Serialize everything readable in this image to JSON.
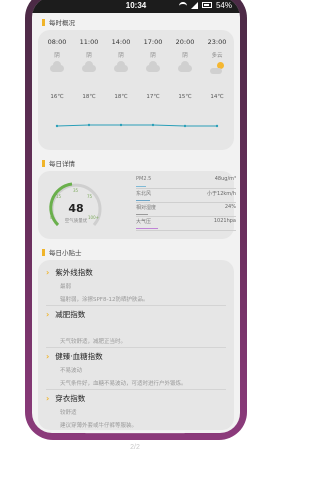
{
  "status": {
    "time": "10:34",
    "battery": "54%"
  },
  "hourly": {
    "title": "每时概况",
    "hours": [
      {
        "time": "08:00",
        "weather": "阴",
        "icon": "cloud-icon",
        "temp": "16℃"
      },
      {
        "time": "11:00",
        "weather": "阴",
        "icon": "cloud-icon",
        "temp": "18℃"
      },
      {
        "time": "14:00",
        "weather": "阴",
        "icon": "cloud-icon",
        "temp": "18℃"
      },
      {
        "time": "17:00",
        "weather": "阴",
        "icon": "cloud-icon",
        "temp": "17℃"
      },
      {
        "time": "20:00",
        "weather": "阴",
        "icon": "cloud-icon",
        "temp": "15℃"
      },
      {
        "time": "23:00",
        "weather": "多云",
        "icon": "sun-cloud-icon",
        "temp": "14℃"
      }
    ]
  },
  "daily": {
    "title": "每日详情",
    "aqi_value": "48",
    "aqi_label": "空气质量优",
    "ticks": [
      "0",
      "15",
      "35",
      "75",
      "100+"
    ],
    "metrics": [
      {
        "name": "PM2.5",
        "value": "48ug/m³",
        "color": "#7fbad6"
      },
      {
        "name": "东北风",
        "value": "小于12km/h",
        "color": "#6fa6c8"
      },
      {
        "name": "相对湿度",
        "value": "24%",
        "color": "#9a9a9a"
      },
      {
        "name": "大气压",
        "value": "1021hpa",
        "color": "#c084d6"
      }
    ]
  },
  "tips": {
    "title": "每日小贴士",
    "items": [
      {
        "title": "紫外线指数",
        "level": "最弱",
        "desc": "辐射弱，涂擦SPF8-12防晒护肤品。"
      },
      {
        "title": "减肥指数",
        "level": "",
        "desc": "天气较舒适，减肥正当时。"
      },
      {
        "title": "健臻·血糖指数",
        "level": "不易波动",
        "desc": "天气条件好，血糖不易波动，可适时进行户外锻炼。"
      },
      {
        "title": "穿衣指数",
        "level": "较舒适",
        "desc": "建议穿薄外套或牛仔裤等服装。"
      }
    ]
  },
  "pager": "2/2"
}
